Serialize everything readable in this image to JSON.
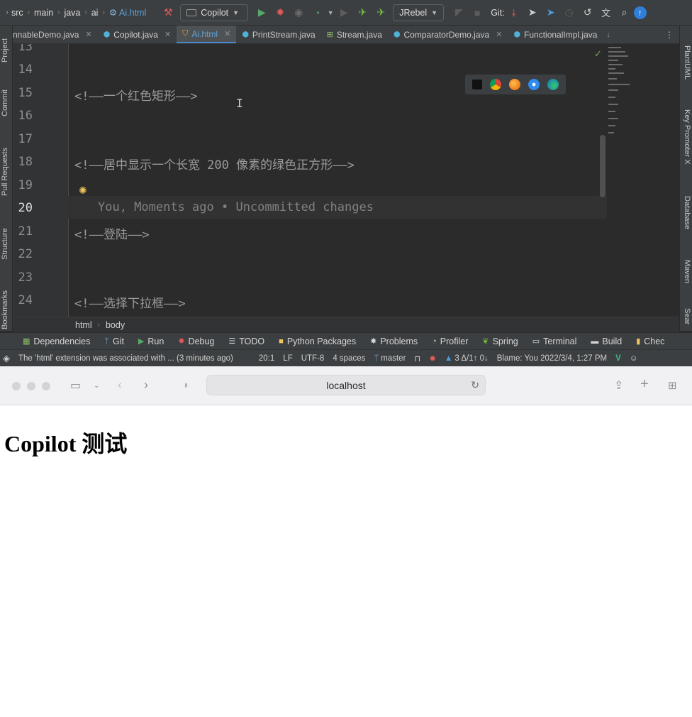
{
  "toolbar": {
    "breadcrumb": [
      "src",
      "main",
      "java",
      "ai"
    ],
    "file": "Ai.html",
    "run_config": "Copilot",
    "jrebel": "JRebel",
    "git_label": "Git:"
  },
  "tabs": [
    {
      "label": "nnableDemo.java"
    },
    {
      "label": "Copilot.java"
    },
    {
      "label": "Ai.html"
    },
    {
      "label": "PrintStream.java"
    },
    {
      "label": "Stream.java"
    },
    {
      "label": "ComparatorDemo.java"
    },
    {
      "label": "FunctionalImpl.java"
    }
  ],
  "left_tools": [
    "Project",
    "Commit",
    "Pull Requests",
    "Structure",
    "Bookmarks"
  ],
  "right_tools": [
    "PlantUML",
    "Key Promoter X",
    "Database",
    "Maven",
    "Sear"
  ],
  "editor": {
    "lines": [
      {
        "n": "13",
        "text": ""
      },
      {
        "n": "14",
        "text": ""
      },
      {
        "n": "15",
        "text": "<!——一个红色矩形——>"
      },
      {
        "n": "16",
        "text": ""
      },
      {
        "n": "17",
        "text": ""
      },
      {
        "n": "18",
        "text": "<!——居中显示一个长宽 200 像素的绿色正方形——>"
      },
      {
        "n": "19",
        "text": ""
      },
      {
        "n": "20",
        "text": ""
      },
      {
        "n": "21",
        "text": "<!——登陆——>"
      },
      {
        "n": "22",
        "text": ""
      },
      {
        "n": "23",
        "text": ""
      },
      {
        "n": "24",
        "text": "<!——选择下拉框——>"
      }
    ],
    "blame": "You, Moments ago • Uncommitted changes",
    "current_line": "20"
  },
  "structure_crumbs": [
    "html",
    "body"
  ],
  "tool_windows": [
    "Dependencies",
    "Git",
    "Run",
    "Debug",
    "TODO",
    "Python Packages",
    "Problems",
    "Profiler",
    "Spring",
    "Terminal",
    "Build",
    "Chec"
  ],
  "status": {
    "message": "The 'html' extension was associated with ... (3 minutes ago)",
    "position": "20:1",
    "line_sep": "LF",
    "encoding": "UTF-8",
    "indent": "4 spaces",
    "branch": "master",
    "changes": "3 Δ/1↑ 0↓",
    "blame": "Blame: You 2022/3/4, 1:27 PM"
  },
  "browser": {
    "url": "localhost",
    "heading": "Copilot 测试"
  }
}
